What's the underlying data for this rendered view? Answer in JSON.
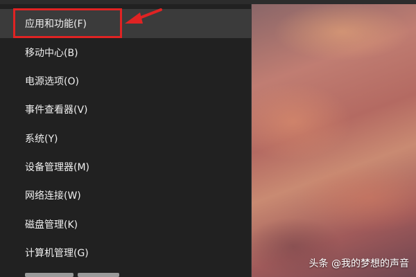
{
  "menu": {
    "items": [
      {
        "label": "应用和功能(F)"
      },
      {
        "label": "移动中心(B)"
      },
      {
        "label": "电源选项(O)"
      },
      {
        "label": "事件查看器(V)"
      },
      {
        "label": "系统(Y)"
      },
      {
        "label": "设备管理器(M)"
      },
      {
        "label": "网络连接(W)"
      },
      {
        "label": "磁盘管理(K)"
      },
      {
        "label": "计算机管理(G)"
      }
    ]
  },
  "annotation": {
    "highlight_color": "#e02323"
  },
  "watermark": {
    "text": "头条 @我的梦想的声音"
  }
}
